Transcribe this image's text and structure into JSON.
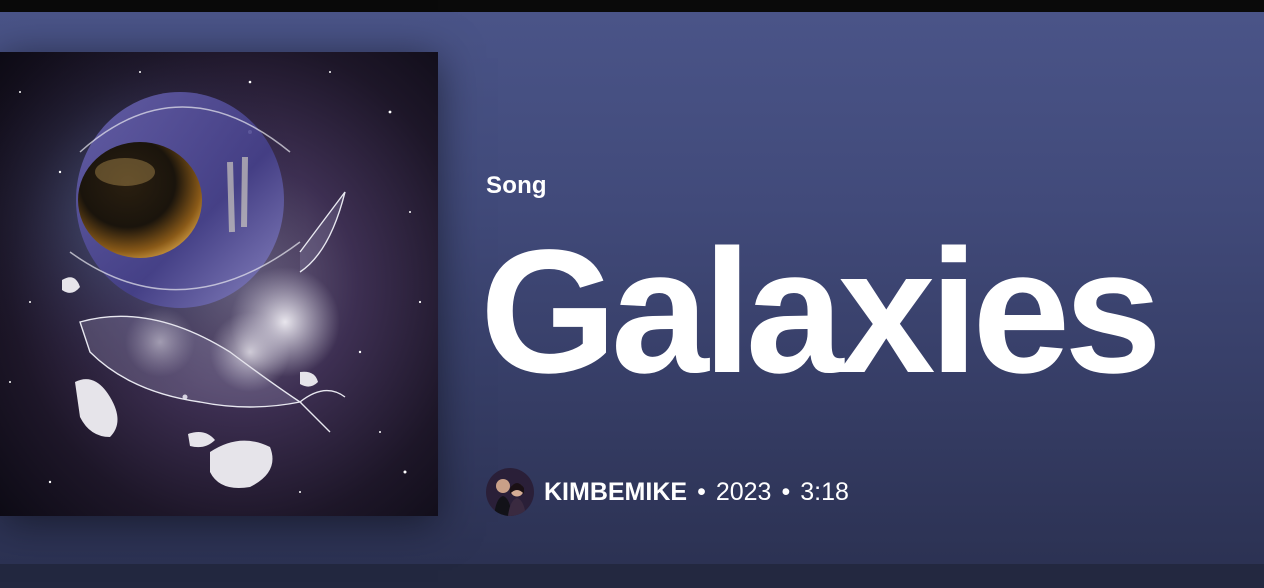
{
  "track": {
    "kind_label": "Song",
    "title": "Galaxies",
    "artist": "KIMBEMIKE",
    "separator": "•",
    "year": "2023",
    "duration": "3:18"
  },
  "images": {
    "cover_icon": "album-cover-astronaut-whale",
    "avatar_icon": "artist-avatar-photo"
  },
  "colors": {
    "header_top": "#4a5488",
    "header_bottom": "#2c3253",
    "text": "#ffffff"
  }
}
